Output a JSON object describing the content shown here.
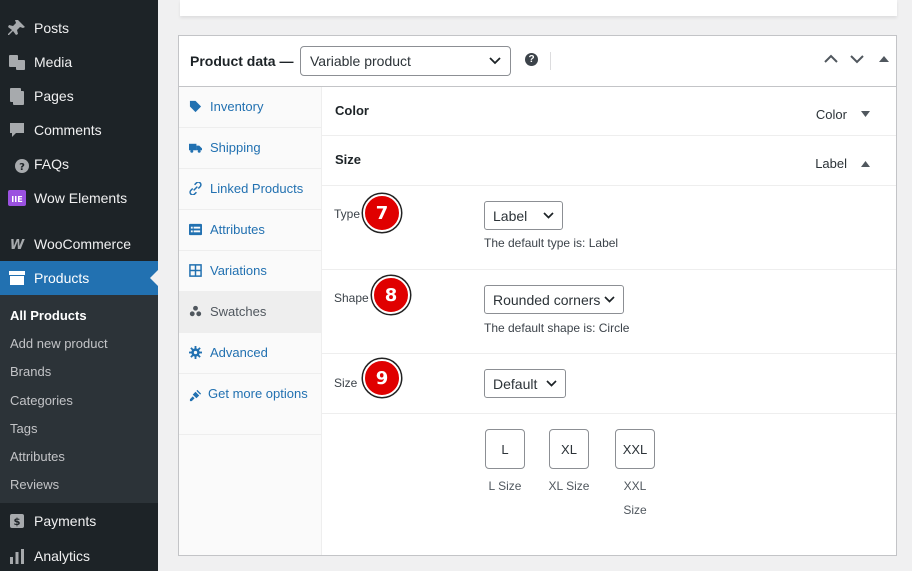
{
  "sidebar": {
    "menu": [
      {
        "label": "Posts",
        "icon": "pin-icon"
      },
      {
        "label": "Media",
        "icon": "media-icon"
      },
      {
        "label": "Pages",
        "icon": "pages-icon"
      },
      {
        "label": "Comments",
        "icon": "comments-icon"
      },
      {
        "label": "FAQs",
        "icon": "question-icon"
      },
      {
        "label": "Wow Elements",
        "icon": "elements-icon"
      },
      {
        "label": "WooCommerce",
        "icon": "woo-icon"
      },
      {
        "label": "Products",
        "icon": "archive-icon"
      }
    ],
    "submenu": [
      "All Products",
      "Add new product",
      "Brands",
      "Categories",
      "Tags",
      "Attributes",
      "Reviews"
    ],
    "bottom": [
      {
        "label": "Payments",
        "icon": "payments-icon"
      },
      {
        "label": "Analytics",
        "icon": "analytics-icon"
      }
    ],
    "accent": "#2271b1"
  },
  "panel": {
    "title": "Product data —",
    "product_type": "Variable product"
  },
  "tabs": [
    {
      "label": "Inventory",
      "icon": "tag-icon"
    },
    {
      "label": "Shipping",
      "icon": "truck-icon"
    },
    {
      "label": "Linked Products",
      "icon": "link-icon"
    },
    {
      "label": "Attributes",
      "icon": "list-icon"
    },
    {
      "label": "Variations",
      "icon": "grid-icon"
    },
    {
      "label": "Swatches",
      "icon": "dots-icon"
    },
    {
      "label": "Advanced",
      "icon": "gear-icon"
    },
    {
      "label": "Get more options",
      "icon": "plug-icon"
    }
  ],
  "content": {
    "color_attr": {
      "name": "Color",
      "type": "Color"
    },
    "size_attr": {
      "name": "Size",
      "type": "Label"
    },
    "type_field": {
      "label": "Type",
      "badge": "7",
      "value": "Label",
      "help": "The default type is: Label"
    },
    "shape_field": {
      "label": "Shape",
      "badge": "8",
      "value": "Rounded corners",
      "help": "The default shape is: Circle"
    },
    "size_field": {
      "label": "Size",
      "badge": "9",
      "value": "Default"
    },
    "swatches": [
      {
        "value": "L",
        "caption": "L Size"
      },
      {
        "value": "XL",
        "caption": "XL Size"
      },
      {
        "value": "XXL",
        "caption": "XXL Size"
      }
    ]
  }
}
